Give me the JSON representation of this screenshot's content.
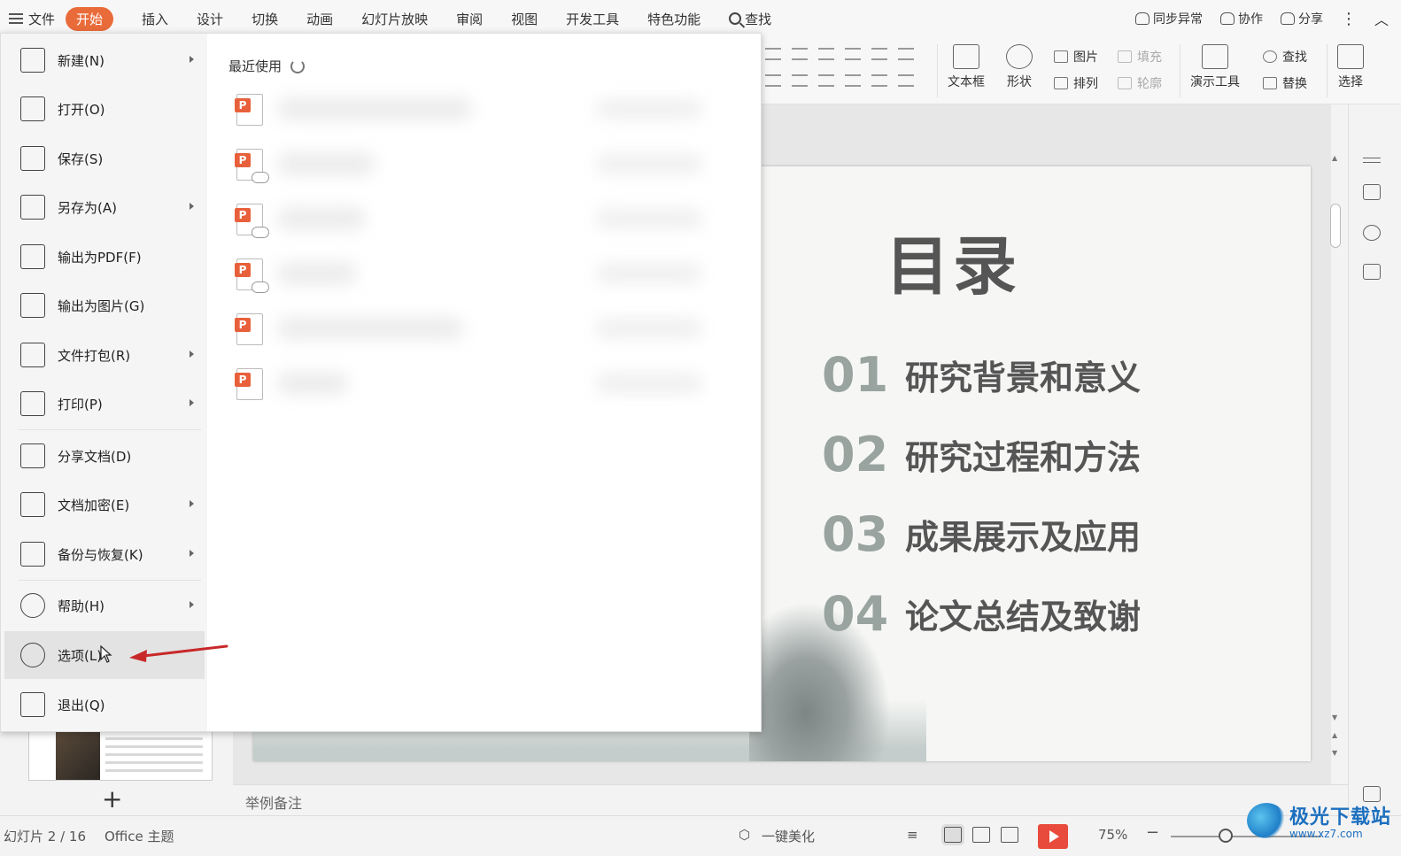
{
  "menubar": {
    "file_label": "文件",
    "start_tab": "开始",
    "tabs": [
      "插入",
      "设计",
      "切换",
      "动画",
      "幻灯片放映",
      "审阅",
      "视图",
      "开发工具",
      "特色功能"
    ],
    "search_label": "查找",
    "sync_label": "同步异常",
    "collab_label": "协作",
    "share_label": "分享"
  },
  "ribbon": {
    "textbox_label": "文本框",
    "shape_label": "形状",
    "picture_label": "图片",
    "fill_label": "填充",
    "arrange_label": "排列",
    "outline_label": "轮廓",
    "present_tools_label": "演示工具",
    "find_label": "查找",
    "replace_label": "替换",
    "select_label": "选择"
  },
  "file_menu": {
    "items": [
      {
        "label": "新建(N)",
        "icon": "new-file-icon",
        "arrow": true
      },
      {
        "label": "打开(O)",
        "icon": "folder-open-icon",
        "arrow": false
      },
      {
        "label": "保存(S)",
        "icon": "save-icon",
        "arrow": false
      },
      {
        "label": "另存为(A)",
        "icon": "save-as-icon",
        "arrow": true
      },
      {
        "label": "输出为PDF(F)",
        "icon": "export-pdf-icon",
        "arrow": false
      },
      {
        "label": "输出为图片(G)",
        "icon": "export-image-icon",
        "arrow": false
      },
      {
        "label": "文件打包(R)",
        "icon": "package-icon",
        "arrow": true
      },
      {
        "label": "打印(P)",
        "icon": "print-icon",
        "arrow": true
      },
      {
        "label": "分享文档(D)",
        "icon": "share-doc-icon",
        "arrow": false
      },
      {
        "label": "文档加密(E)",
        "icon": "encrypt-icon",
        "arrow": true
      },
      {
        "label": "备份与恢复(K)",
        "icon": "backup-icon",
        "arrow": true
      },
      {
        "label": "帮助(H)",
        "icon": "help-icon",
        "arrow": true
      },
      {
        "label": "选项(L)",
        "icon": "gear-icon",
        "arrow": false,
        "hover": true
      },
      {
        "label": "退出(Q)",
        "icon": "exit-icon",
        "arrow": false
      }
    ],
    "recent_title": "最近使用"
  },
  "slide": {
    "title": "目录",
    "toc": [
      {
        "num": "01",
        "text": "研究背景和意义"
      },
      {
        "num": "02",
        "text": "研究过程和方法"
      },
      {
        "num": "03",
        "text": "成果展示及应用"
      },
      {
        "num": "04",
        "text": "论文总结及致谢"
      }
    ]
  },
  "notes": {
    "placeholder": "举例备注"
  },
  "statusbar": {
    "slide_counter": "幻灯片 2 / 16",
    "theme": "Office 主题",
    "beautify": "一键美化",
    "zoom": "75%"
  },
  "watermark": {
    "title": "极光下载站",
    "url": "www.xz7.com"
  },
  "colors": {
    "accent": "#e96b3a",
    "annotation_arrow": "#c8282a",
    "play": "#e84a3b"
  }
}
